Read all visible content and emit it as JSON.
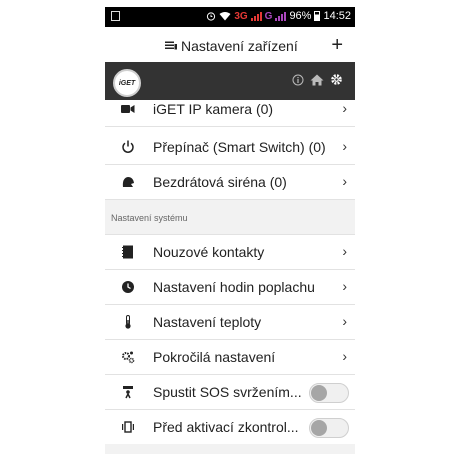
{
  "status_bar": {
    "battery": "96%",
    "time": "14:52",
    "network_3g": "3G",
    "network_g": "G",
    "icons": [
      "image-icon",
      "alarm-icon",
      "wifi-icon",
      "signal-icon",
      "battery-icon"
    ]
  },
  "header": {
    "title": "Nastavení zařízení",
    "title_icon": "device-list-icon",
    "add_icon": "plus-icon",
    "add_label": "+"
  },
  "app_bar": {
    "logo_text": "iGET",
    "icons": [
      "info-icon",
      "home-icon",
      "gear-icon"
    ],
    "background": "#333333"
  },
  "device_items": [
    {
      "label": "iGET IP kamera (0)",
      "icon": "camera-icon",
      "chevron": "›"
    },
    {
      "label": "Přepínač (Smart Switch) (0)",
      "icon": "power-icon",
      "chevron": "›"
    },
    {
      "label": "Bezdrátová siréna (0)",
      "icon": "siren-icon",
      "chevron": "›"
    }
  ],
  "section_label": "Nastavení systému",
  "system_items": [
    {
      "label": "Nouzové kontakty",
      "icon": "contacts-book-icon",
      "chevron": "›"
    },
    {
      "label": "Nastavení hodin poplachu",
      "icon": "clock-icon",
      "chevron": "›"
    },
    {
      "label": "Nastavení teploty",
      "icon": "thermometer-icon",
      "chevron": "›"
    },
    {
      "label": "Pokročilá nastavení",
      "icon": "gears-icon",
      "chevron": "›"
    }
  ],
  "toggle_items": [
    {
      "label": "Spustit SOS svržením...",
      "icon": "fall-icon",
      "state": "off"
    },
    {
      "label": "Před aktivací zkontrol...",
      "icon": "vibrate-icon",
      "state": "off"
    }
  ]
}
